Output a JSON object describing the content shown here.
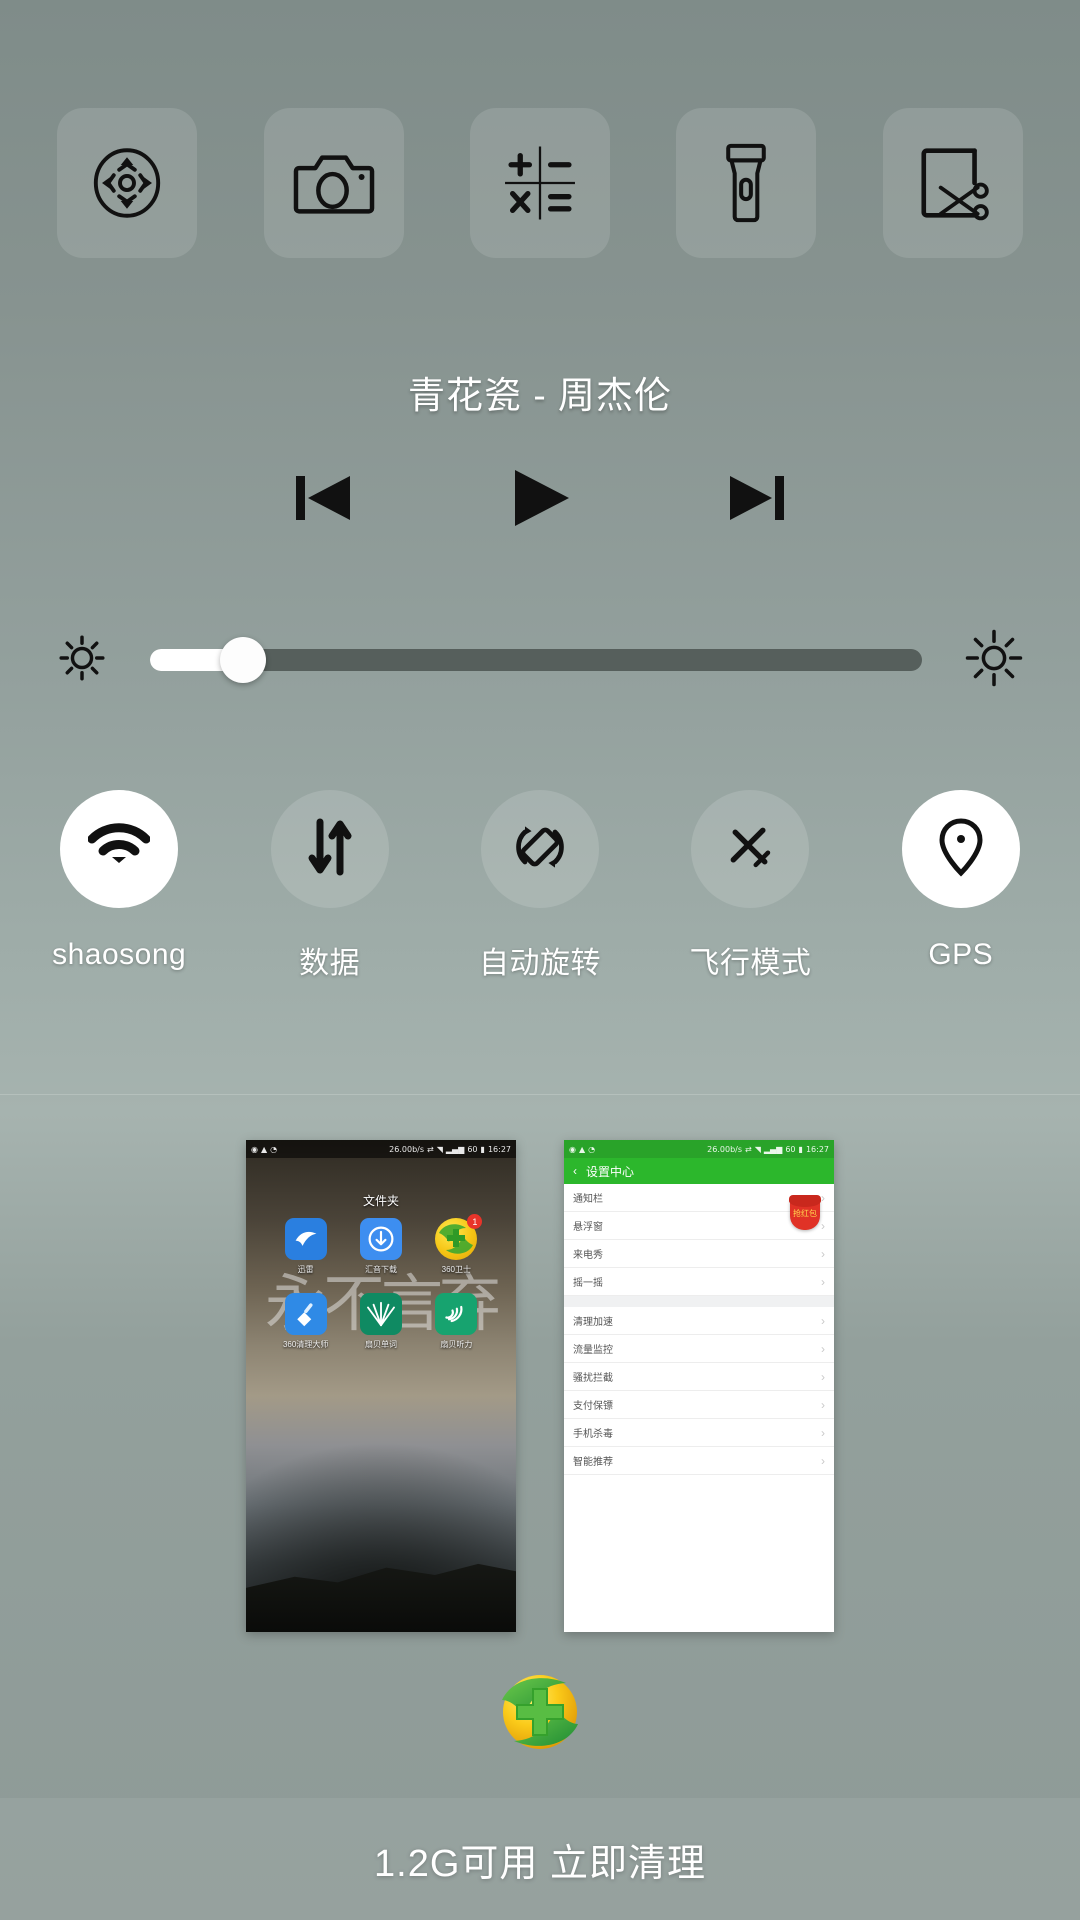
{
  "shortcuts": [
    {
      "name": "screen-lock-dpad-icon",
      "label": ""
    },
    {
      "name": "camera-icon",
      "label": ""
    },
    {
      "name": "calculator-icon",
      "label": ""
    },
    {
      "name": "flashlight-icon",
      "label": ""
    },
    {
      "name": "screenshot-scissors-icon",
      "label": ""
    }
  ],
  "music": {
    "title": "青花瓷 - 周杰伦",
    "prev_label": "",
    "play_label": "",
    "next_label": ""
  },
  "brightness": {
    "value": 12,
    "min_icon": "brightness-low-icon",
    "max_icon": "brightness-high-icon"
  },
  "toggles": [
    {
      "label": "shaosong",
      "icon": "wifi-icon",
      "active": true
    },
    {
      "label": "数据",
      "icon": "mobile-data-icon",
      "active": false
    },
    {
      "label": "自动旋转",
      "icon": "auto-rotate-icon",
      "active": false
    },
    {
      "label": "飞行模式",
      "icon": "airplane-icon",
      "active": false
    },
    {
      "label": "GPS",
      "icon": "location-pin-icon",
      "active": true
    }
  ],
  "recents": {
    "home_thumb": {
      "statusbar": {
        "speed": "26.00b/s",
        "battery": "60",
        "time": "16:27"
      },
      "folder_title": "文件夹",
      "apps": [
        {
          "name": "迅雷",
          "badge": ""
        },
        {
          "name": "汇音下载",
          "badge": ""
        },
        {
          "name": "360卫士",
          "badge": "1"
        },
        {
          "name": "360清理大师",
          "badge": ""
        },
        {
          "name": "扇贝单词",
          "badge": ""
        },
        {
          "name": "扇贝听力",
          "badge": ""
        }
      ],
      "wallpaper_text": "永不言弃"
    },
    "settings_thumb": {
      "statusbar": {
        "speed": "26.00b/s",
        "battery": "60",
        "time": "16:27"
      },
      "header_title": "设置中心",
      "back_icon": "chevron-left-icon",
      "promo_badge": "抢红包",
      "items_group_1": [
        "通知栏",
        "悬浮窗",
        "来电秀",
        "摇一摇"
      ],
      "items_group_2": [
        "清理加速",
        "流量监控",
        "骚扰拦截",
        "支付保镖",
        "手机杀毒",
        "智能推荐"
      ]
    }
  },
  "bottom": {
    "clean_logo": "360-security-logo",
    "clean_text": "1.2G可用 立即清理"
  }
}
